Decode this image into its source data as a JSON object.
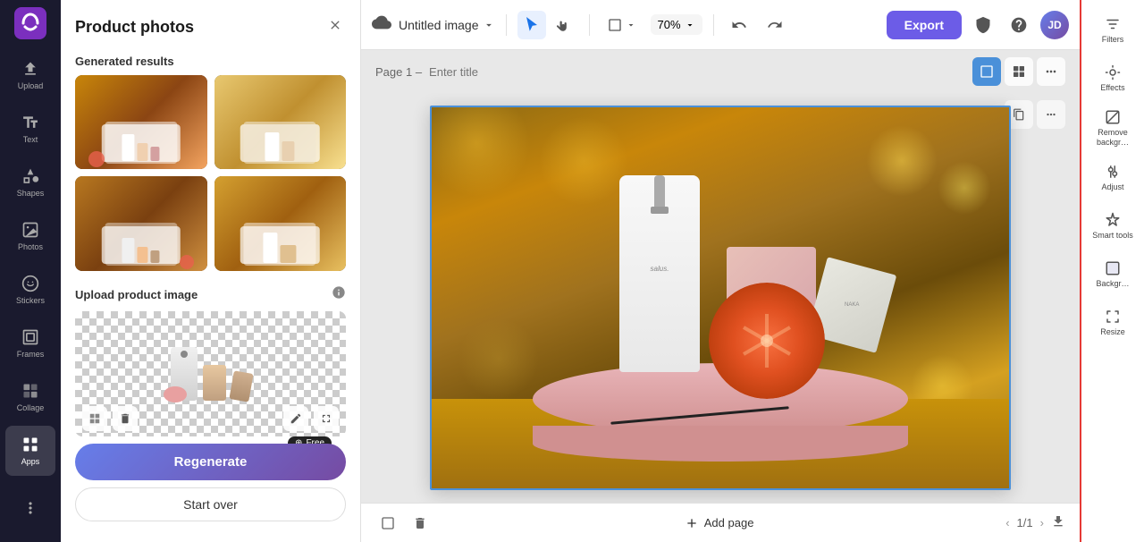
{
  "app": {
    "logo_text": "C",
    "title": "Canva"
  },
  "left_toolbar": {
    "items": [
      {
        "id": "upload",
        "label": "Upload",
        "icon": "upload"
      },
      {
        "id": "text",
        "label": "Text",
        "icon": "text"
      },
      {
        "id": "shapes",
        "label": "Shapes",
        "icon": "shapes"
      },
      {
        "id": "photos",
        "label": "Photos",
        "icon": "photos"
      },
      {
        "id": "stickers",
        "label": "Stickers",
        "icon": "stickers"
      },
      {
        "id": "frames",
        "label": "Frames",
        "icon": "frames"
      },
      {
        "id": "collage",
        "label": "Collage",
        "icon": "collage"
      },
      {
        "id": "apps",
        "label": "Apps",
        "icon": "apps"
      },
      {
        "id": "more",
        "label": "",
        "icon": "more"
      }
    ]
  },
  "panel": {
    "title": "Product photos",
    "close_label": "×",
    "generated_section_title": "Generated results",
    "upload_section_title": "Upload product image",
    "regenerate_label": "Regenerate",
    "start_over_label": "Start over",
    "free_badge": "Free"
  },
  "top_toolbar": {
    "doc_icon": "cloud-save",
    "doc_title": "Untitled image",
    "doc_arrow": "▾",
    "tools": [
      "select",
      "hand",
      "frame",
      "zoom"
    ],
    "zoom_value": "70%",
    "undo_label": "undo",
    "redo_label": "redo",
    "export_label": "Export",
    "shield_icon": "shield",
    "help_icon": "help"
  },
  "canvas": {
    "page_label": "Page 1 –",
    "page_title_placeholder": "Enter title",
    "copy_icon": "copy",
    "more_icon": "more"
  },
  "bottom_bar": {
    "trash_icon": "trash",
    "add_page_label": "Add page",
    "page_current": "1",
    "page_total": "1",
    "download_icon": "download"
  },
  "right_panel": {
    "items": [
      {
        "id": "filters",
        "label": "Filters",
        "icon": "filter"
      },
      {
        "id": "effects",
        "label": "Effects",
        "icon": "effects"
      },
      {
        "id": "remove-bg",
        "label": "Remove backgr…",
        "icon": "remove-bg"
      },
      {
        "id": "adjust",
        "label": "Adjust",
        "icon": "adjust"
      },
      {
        "id": "smart-tools",
        "label": "Smart tools",
        "icon": "smart"
      },
      {
        "id": "background",
        "label": "Backgr…",
        "icon": "background"
      },
      {
        "id": "resize",
        "label": "Resize",
        "icon": "resize"
      }
    ]
  }
}
